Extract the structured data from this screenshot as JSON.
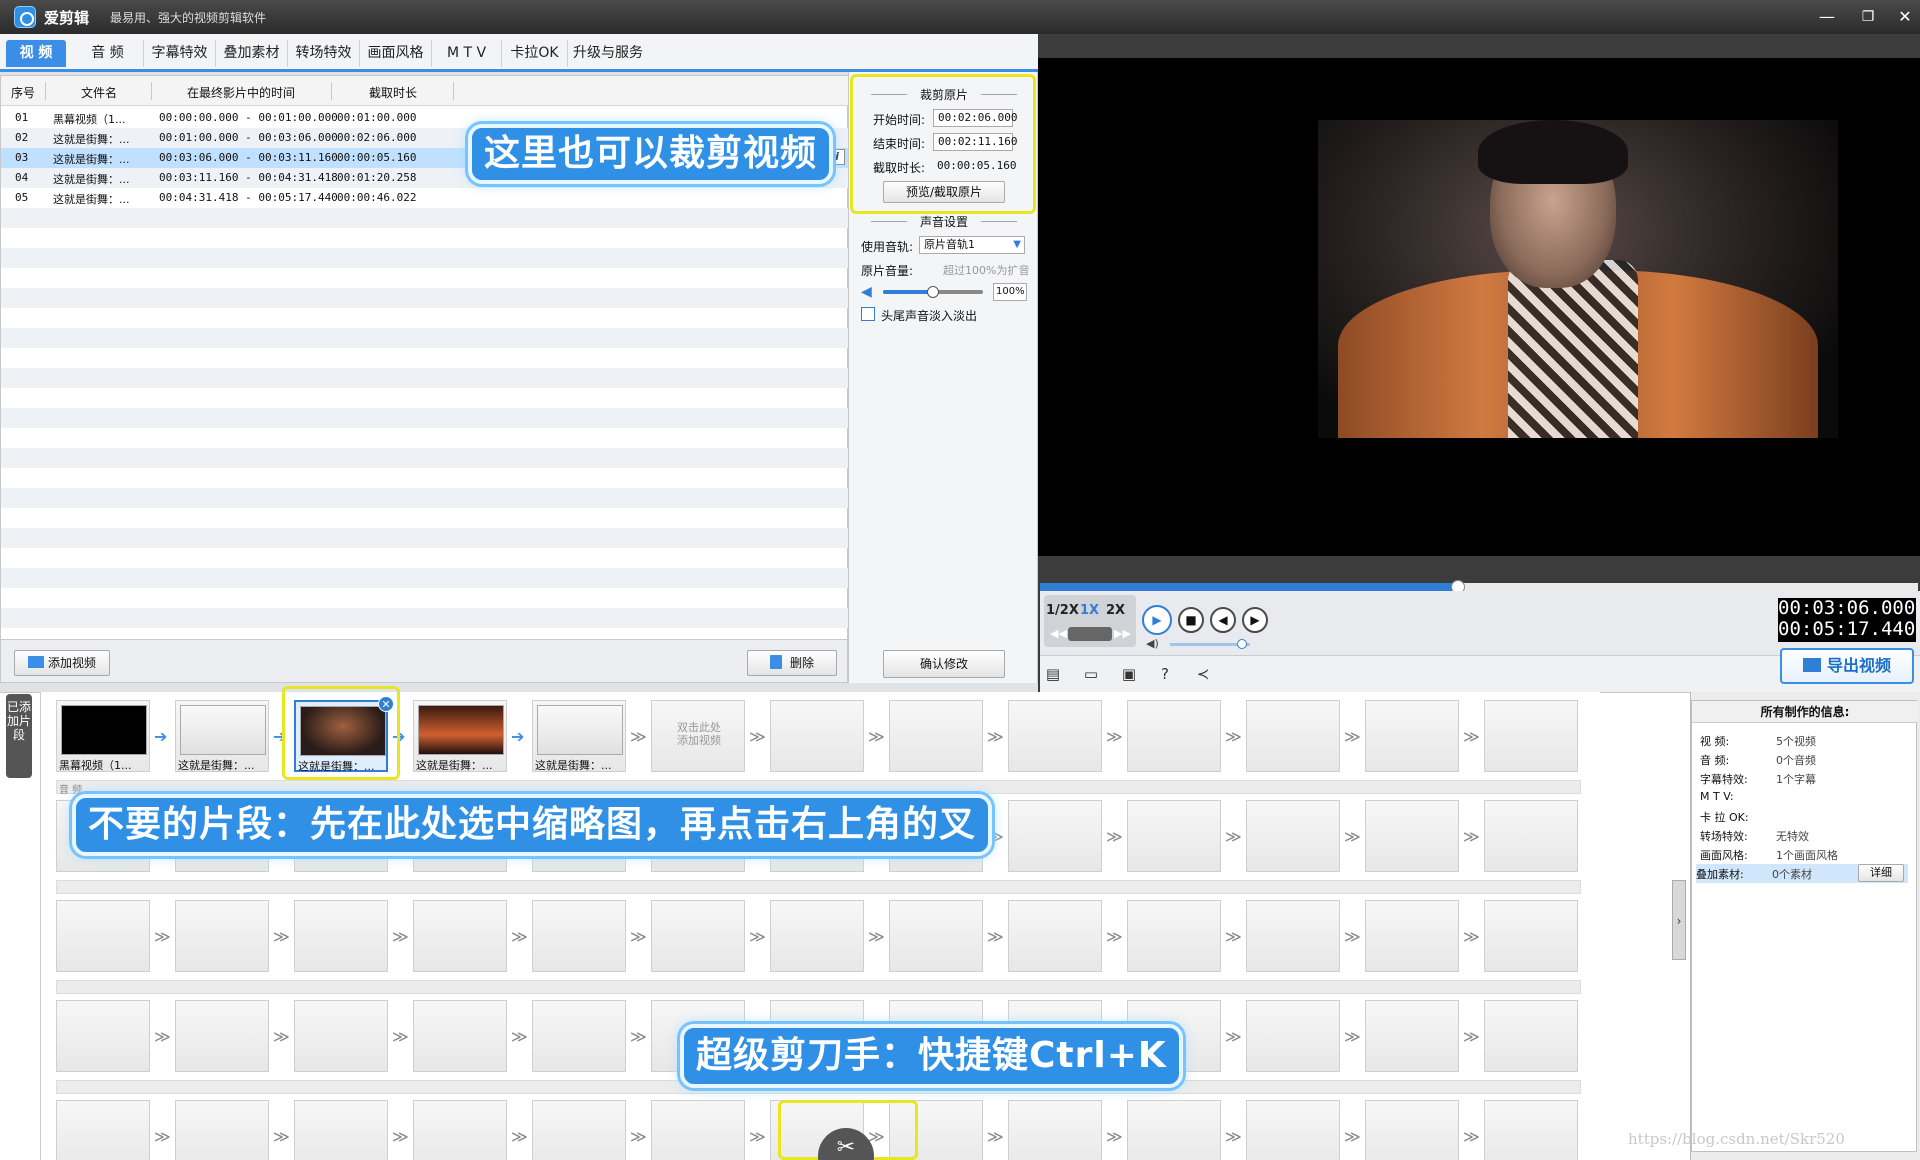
{
  "window": {
    "app_name": "爱剪辑",
    "slogan": "最易用、强大的视频剪辑软件"
  },
  "tabs": [
    "视  频",
    "音  频",
    "字幕特效",
    "叠加素材",
    "转场特效",
    "画面风格",
    "M T V",
    "卡拉OK",
    "升级与服务"
  ],
  "list": {
    "headers": [
      "序号",
      "文件名",
      "在最终影片中的时间",
      "截取时长"
    ],
    "rows": [
      {
        "no": "01",
        "name": "黑幕视频（1...",
        "time": "00:00:00.000 - 00:01:00.000",
        "dur": "00:01:00.000"
      },
      {
        "no": "02",
        "name": "这就是街舞：...",
        "time": "00:01:00.000 - 00:03:06.000",
        "dur": "00:02:06.000"
      },
      {
        "no": "03",
        "name": "这就是街舞：...",
        "time": "00:03:06.000 - 00:03:11.160",
        "dur": "00:00:05.160"
      },
      {
        "no": "04",
        "name": "这就是街舞：...",
        "time": "00:03:11.160 - 00:04:31.418",
        "dur": "00:01:20.258"
      },
      {
        "no": "05",
        "name": "这就是街舞：...",
        "time": "00:04:31.418 - 00:05:17.440",
        "dur": "00:00:46.022"
      }
    ],
    "add_button": "添加视频",
    "delete_button": "删除"
  },
  "trim": {
    "title": "裁剪原片",
    "start_label": "开始时间:",
    "start_value": "00:02:06.000",
    "end_label": "结束时间:",
    "end_value": "00:02:11.160",
    "duration_label": "截取时长:",
    "duration_value": "00:00:05.160",
    "preview_button": "预览/截取原片"
  },
  "audio": {
    "title": "声音设置",
    "track_label": "使用音轨:",
    "track_value": "原片音轨1",
    "volume_label": "原片音量:",
    "volume_hint": "超过100%为扩音",
    "volume_value": "100%",
    "volume_fraction": 0.5,
    "fade_label": "头尾声音淡入淡出",
    "confirm_button": "确认修改"
  },
  "player": {
    "speeds": [
      "1/2X",
      "1X",
      "2X"
    ],
    "seek_fraction": 0.476,
    "time_current": "00:03:06.000",
    "time_total": "00:05:17.440",
    "volume_fraction": 0.9,
    "export_button": "导出视频"
  },
  "timeline": {
    "added_tab": "已添加片段",
    "audio_track_label": "音 频",
    "clips": [
      {
        "caption": "黑幕视频（1..."
      },
      {
        "caption": "这就是街舞：..."
      },
      {
        "caption": "这就是街舞：..."
      },
      {
        "caption": "这就是街舞：..."
      },
      {
        "caption": "这就是街舞：..."
      }
    ],
    "add_hint_1": "双击此处",
    "add_hint_2": "添加视频"
  },
  "info": {
    "title": "所有制作的信息:",
    "rows": [
      {
        "k": "视    频:",
        "v": "5个视频"
      },
      {
        "k": "音    频:",
        "v": "0个音频"
      },
      {
        "k": "字幕特效:",
        "v": "1个字幕"
      },
      {
        "k": "M   T  V:",
        "v": ""
      },
      {
        "k": "卡 拉 OK:",
        "v": ""
      },
      {
        "k": "转场特效:",
        "v": "无特效"
      },
      {
        "k": "画面风格:",
        "v": "1个画面风格"
      },
      {
        "k": "叠加素材:",
        "v": "0个素材"
      }
    ],
    "detail_button": "详细"
  },
  "callouts": {
    "trim_here": "这里也可以裁剪视频",
    "remove_clip": "不要的片段：先在此处选中缩略图，再点击右上角的叉",
    "super_cut": "超级剪刀手：快捷键Ctrl+K"
  },
  "watermark": "https://blog.csdn.net/Skr520"
}
